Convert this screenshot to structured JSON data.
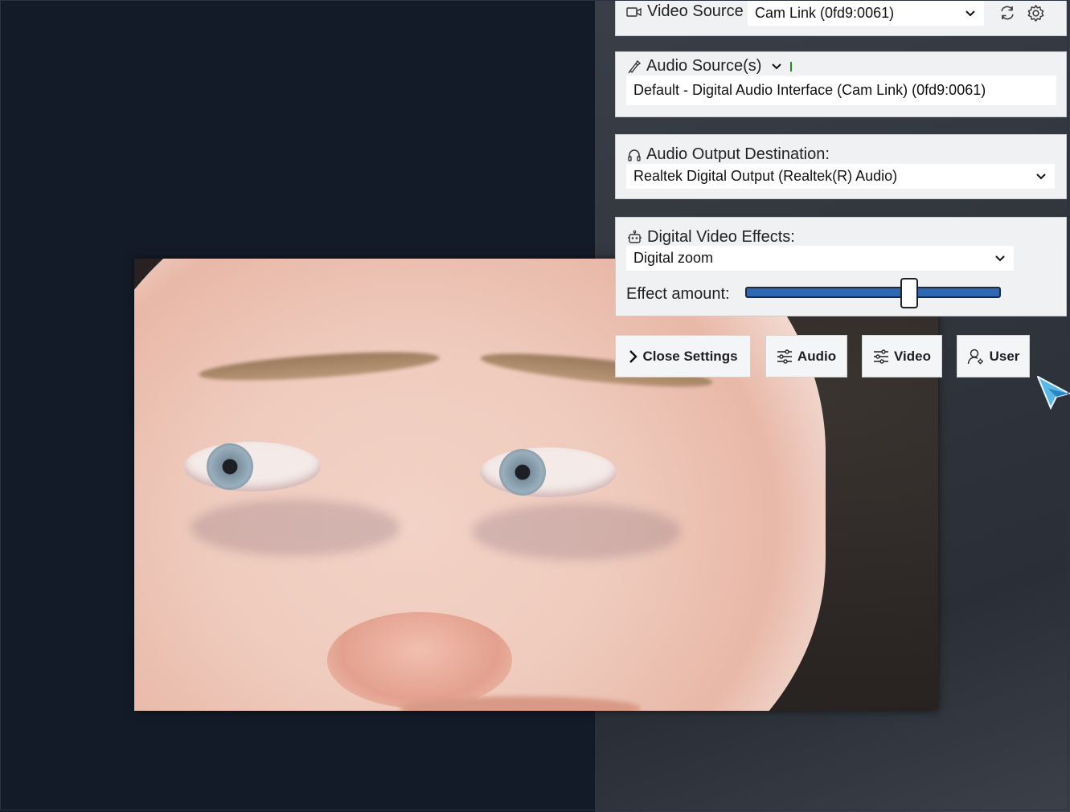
{
  "video_source": {
    "label": "Video Source",
    "selected": "Cam Link (0fd9:0061)"
  },
  "audio_sources": {
    "label": "Audio Source(s)",
    "selected": "Default - Digital Audio Interface (Cam Link) (0fd9:0061)"
  },
  "audio_output": {
    "label": "Audio Output Destination:",
    "selected": "Realtek Digital Output (Realtek(R) Audio)"
  },
  "video_effects": {
    "label": "Digital Video Effects:",
    "selected": "Digital zoom",
    "amount_label": "Effect amount:",
    "amount_fraction": 0.64
  },
  "buttons": {
    "close_settings": "Close Settings",
    "audio": "Audio",
    "video": "Video",
    "user": "User"
  },
  "colors": {
    "slider_fill": "#2e68b5",
    "mic_level": "#1a8f1a",
    "page_bg": "#141b28"
  }
}
